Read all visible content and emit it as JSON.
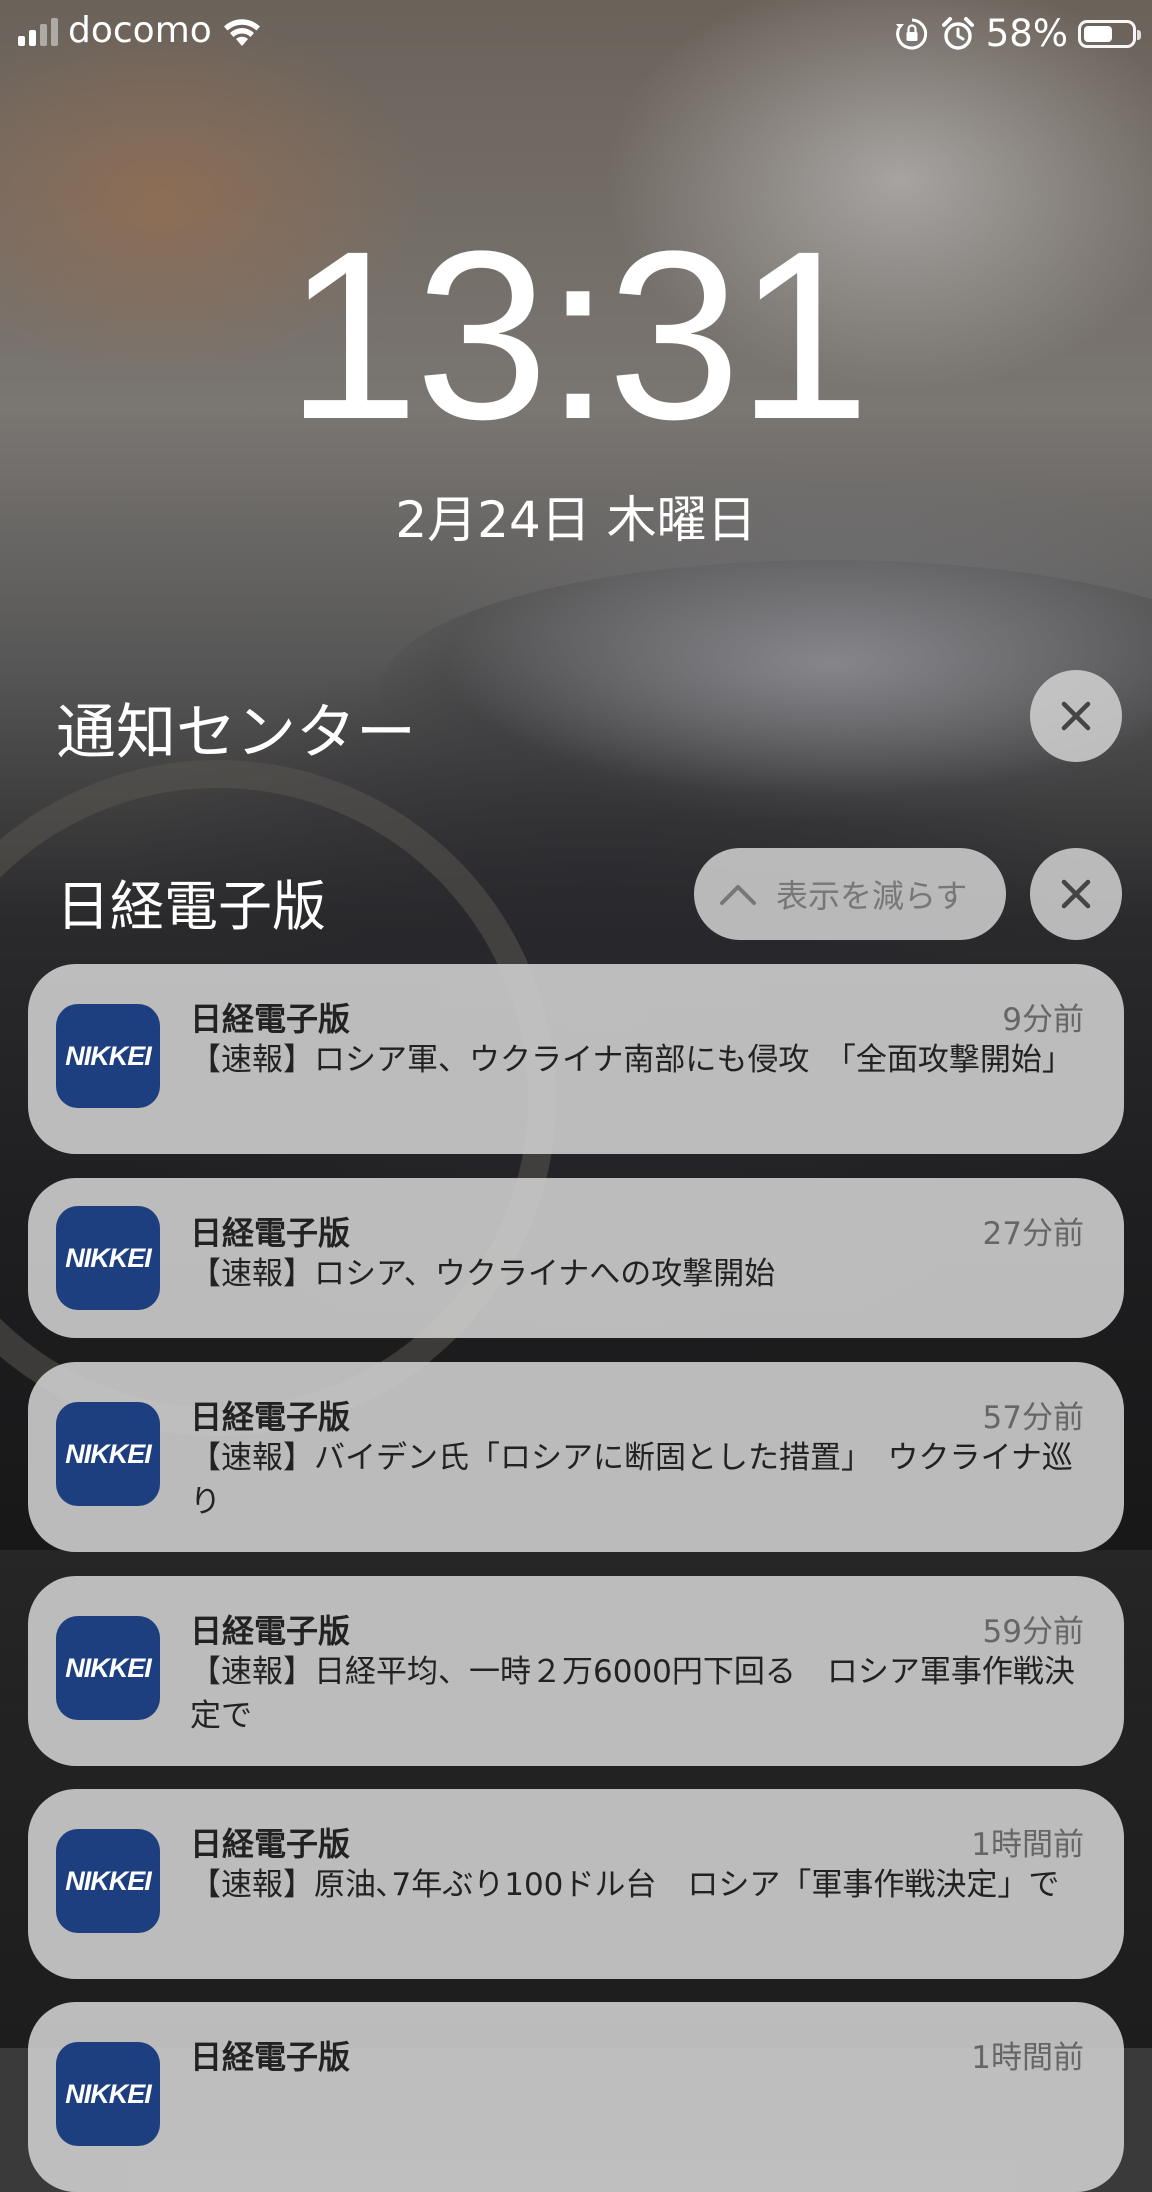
{
  "status_bar": {
    "carrier": "docomo",
    "battery_percent": "58%",
    "battery_level": 0.58,
    "icons": [
      "signal-icon",
      "wifi-icon",
      "orientation-lock-icon",
      "alarm-icon",
      "battery-icon"
    ]
  },
  "lock_screen": {
    "time": "13:31",
    "date": "2月24日 木曜日"
  },
  "notification_center": {
    "title": "通知センター"
  },
  "group": {
    "app_title": "日経電子版",
    "show_less_label": "表示を減らす"
  },
  "notifications": [
    {
      "app": "日経電子版",
      "icon_text": "NIKKEI",
      "time": "9分前",
      "body": "【速報】ロシア軍、ウクライナ南部にも侵攻　「全面攻撃開始」"
    },
    {
      "app": "日経電子版",
      "icon_text": "NIKKEI",
      "time": "27分前",
      "body": "【速報】ロシア、ウクライナへの攻撃開始"
    },
    {
      "app": "日経電子版",
      "icon_text": "NIKKEI",
      "time": "57分前",
      "body": "【速報】バイデン氏「ロシアに断固とした措置」　ウクライナ巡り"
    },
    {
      "app": "日経電子版",
      "icon_text": "NIKKEI",
      "time": "59分前",
      "body": "【速報】日経平均、一時２万6000円下回る　ロシア軍事作戦決定で"
    },
    {
      "app": "日経電子版",
      "icon_text": "NIKKEI",
      "time": "1時間前",
      "body": "【速報】原油､7年ぶり100ドル台　ロシア「軍事作戦決定」で"
    },
    {
      "app": "日経電子版",
      "icon_text": "NIKKEI",
      "time": "1時間前",
      "body": ""
    }
  ],
  "colors": {
    "card_bg": "#cdcdcd",
    "icon_bg": "#1d3f80",
    "secondary_text": "#666666"
  }
}
